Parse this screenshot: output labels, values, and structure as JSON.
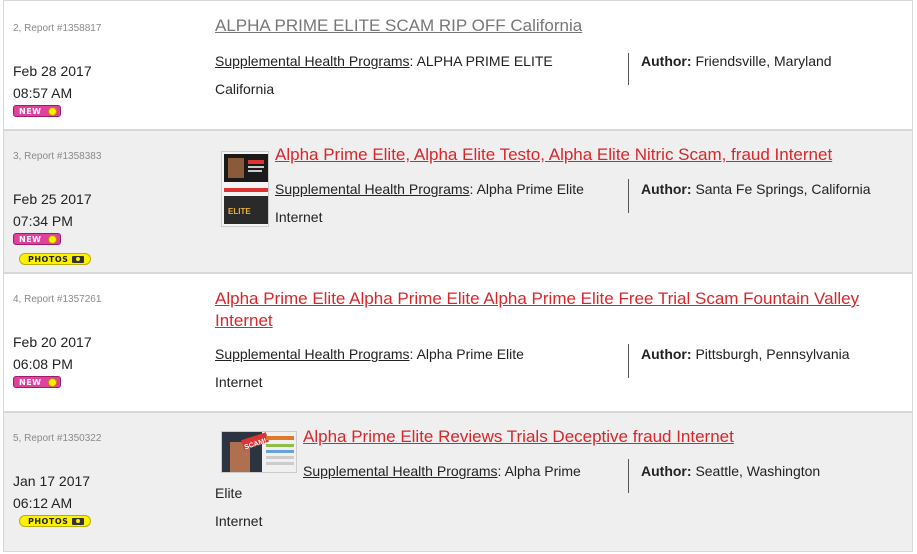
{
  "reports": [
    {
      "report_id": "2, Report #1358817",
      "date": "Feb 28 2017",
      "time": "08:57 AM",
      "badges": [
        "NEW"
      ],
      "title": "ALPHA PRIME ELITE SCAM RIP OFF California",
      "category_link": "Supplemental Health Programs",
      "category_sep": ":",
      "company": "ALPHA PRIME ELITE",
      "location": "California",
      "author_label": "Author:",
      "author": "Friendsville, Maryland"
    },
    {
      "report_id": "3, Report #1358383",
      "date": "Feb 25 2017",
      "time": "07:34 PM",
      "badges": [
        "NEW",
        "PHOTOS"
      ],
      "title": "Alpha Prime Elite, Alpha Elite Testo, Alpha Elite Nitric Scam, fraud Internet",
      "category_link": "Supplemental Health Programs",
      "category_sep": ":",
      "company": "Alpha Prime Elite",
      "location": "Internet",
      "author_label": "Author:",
      "author": "Santa Fe Springs, California"
    },
    {
      "report_id": "4, Report #1357261",
      "date": "Feb 20 2017",
      "time": "06:08 PM",
      "badges": [
        "NEW"
      ],
      "title_line1": "Alpha Prime Elite Alpha Prime Elite Alpha Prime Elite Free Trial Scam Fountain Valley",
      "title_line2": "Internet",
      "category_link": "Supplemental Health Programs",
      "category_sep": ":",
      "company": "Alpha Prime Elite",
      "location": "Internet",
      "author_label": "Author:",
      "author": "Pittsburgh, Pennsylvania"
    },
    {
      "report_id": "5, Report #1350322",
      "date": "Jan 17 2017",
      "time": "06:12 AM",
      "badges": [
        "PHOTOS"
      ],
      "title": "Alpha Prime Elite Reviews Trials Deceptive fraud Internet",
      "category_link": "Supplemental Health Programs",
      "category_sep": ":",
      "company_line1": "Alpha Prime",
      "company_line2": "Elite",
      "location": "Internet",
      "author_label": "Author:",
      "author": "Seattle, Washington"
    }
  ],
  "badge_labels": {
    "new": "NEW",
    "photos": "PHOTOS"
  },
  "thumb_text": {
    "elite": "ELITE",
    "scam": "SCAM!"
  },
  "colors": {
    "title_red": "#d9262b",
    "title_gray": "#777777",
    "badge_new": "#e040a0",
    "badge_photos": "#fff200",
    "row_alt": "#efefef"
  }
}
